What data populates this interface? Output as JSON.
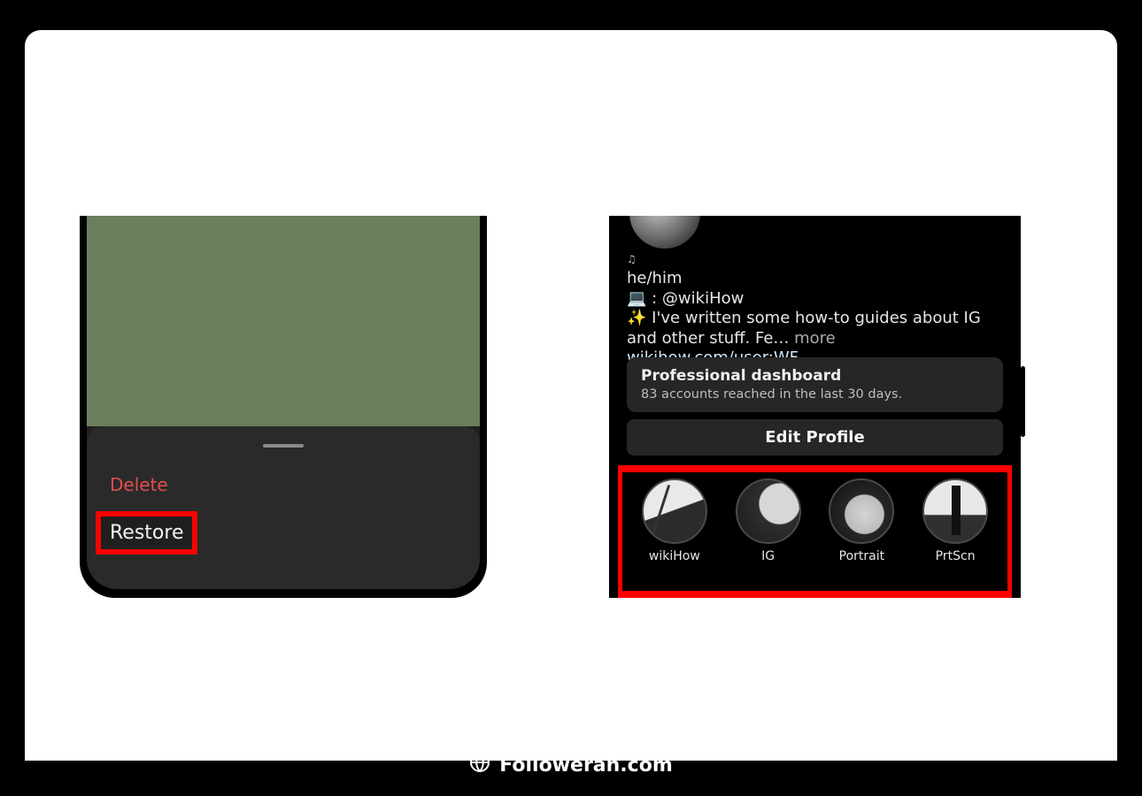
{
  "footer": {
    "site_label": "Followeran.com"
  },
  "left_phone": {
    "sheet": {
      "delete_label": "Delete",
      "restore_label": "Restore"
    }
  },
  "right_phone": {
    "bio": {
      "music_note": "♫",
      "pronouns": "he/him",
      "line_work_prefix": "💻 : ",
      "work_handle": "@wikiHow",
      "line_sparkle_prefix": "✨ ",
      "sparkle_text": "I've written some how-to guides about IG and other stuff. Fe…",
      "more_label": " more",
      "url": "wikihow.com/user:WF"
    },
    "pro_dashboard": {
      "title": "Professional dashboard",
      "subtitle": "83 accounts reached in the last 30 days."
    },
    "edit_profile_label": "Edit Profile",
    "highlights": [
      {
        "label": "wikiHow"
      },
      {
        "label": "IG"
      },
      {
        "label": "Portrait"
      },
      {
        "label": "PrtScn"
      }
    ]
  }
}
